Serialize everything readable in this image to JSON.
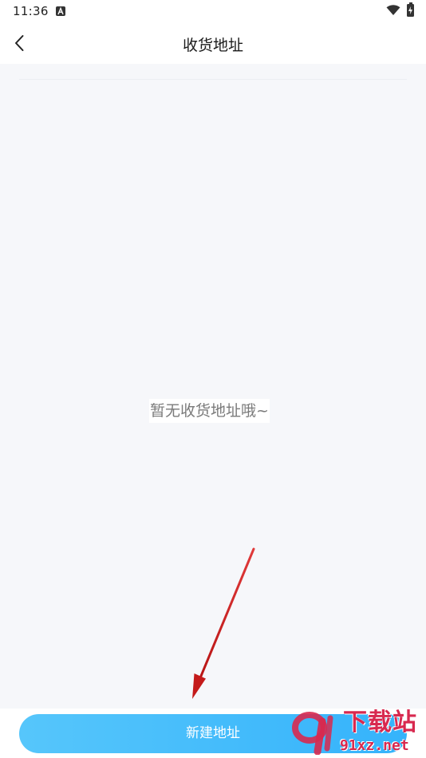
{
  "status_bar": {
    "time": "11:36",
    "notification_icon": "a-icon",
    "wifi_icon": "wifi-icon",
    "battery_icon": "battery-charging-icon"
  },
  "header": {
    "back_icon": "chevron-left-icon",
    "title": "收货地址"
  },
  "content": {
    "empty_message": "暂无收货地址哦~"
  },
  "footer": {
    "new_address_label": "新建地址",
    "button_color_start": "#56c6fb",
    "button_color_end": "#35b3fb"
  },
  "watermark": {
    "brand": "下载站",
    "url": "91xz.net",
    "color": "#d8294f"
  },
  "annotation": {
    "arrow_color": "#d21f1f"
  }
}
